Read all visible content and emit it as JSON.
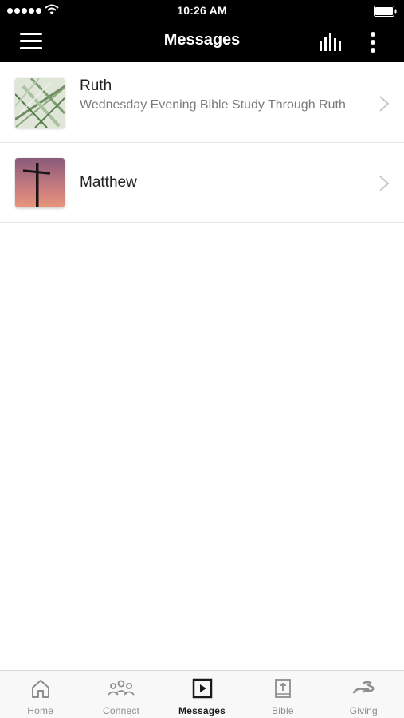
{
  "status_bar": {
    "time": "10:26 AM"
  },
  "nav": {
    "title": "Messages",
    "icons": [
      "menu-icon",
      "audio-bars-icon",
      "more-vertical-icon"
    ]
  },
  "series": [
    {
      "title": "Ruth",
      "subtitle": "Wednesday Evening Bible Study Through Ruth",
      "thumbnail": "palm-leaf-image"
    },
    {
      "title": "Matthew",
      "subtitle": "",
      "thumbnail": "cross-sunset-image"
    }
  ],
  "tabs": [
    {
      "label": "Home",
      "icon": "home-icon",
      "active": false
    },
    {
      "label": "Connect",
      "icon": "people-icon",
      "active": false
    },
    {
      "label": "Messages",
      "icon": "play-square-icon",
      "active": true
    },
    {
      "label": "Bible",
      "icon": "bible-icon",
      "active": false
    },
    {
      "label": "Giving",
      "icon": "giving-hand-icon",
      "active": false
    }
  ],
  "colors": {
    "nav_background": "#000000",
    "tab_active": "#1a1a1a",
    "tab_inactive": "#8e8e8e",
    "subtitle": "#7a7a7a"
  }
}
